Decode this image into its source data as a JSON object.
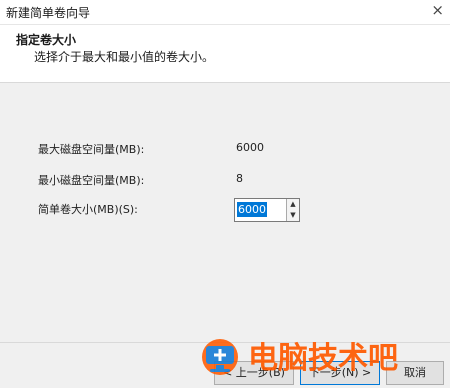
{
  "window": {
    "title": "新建简单卷向导",
    "close_glyph": "×"
  },
  "header": {
    "title": "指定卷大小",
    "subtitle": "选择介于最大和最小值的卷大小。"
  },
  "form": {
    "max_label": "最大磁盘空间量(MB):",
    "max_value": "6000",
    "min_label": "最小磁盘空间量(MB):",
    "min_value": "8",
    "size_label": "简单卷大小(MB)(S):",
    "size_value": "6000"
  },
  "buttons": {
    "back": "< 上一步(B)",
    "next": "下一步(N) >",
    "cancel": "取消"
  },
  "watermark": {
    "text": "电脑技术吧"
  },
  "colors": {
    "accent": "#0078d7",
    "wm_orange": "#ff5a00",
    "wm_blue": "#1a7ed6"
  },
  "icons": {
    "close": "close-icon",
    "spin_up": "chevron-up-icon",
    "spin_down": "chevron-down-icon",
    "logo": "computer-plus-icon"
  }
}
